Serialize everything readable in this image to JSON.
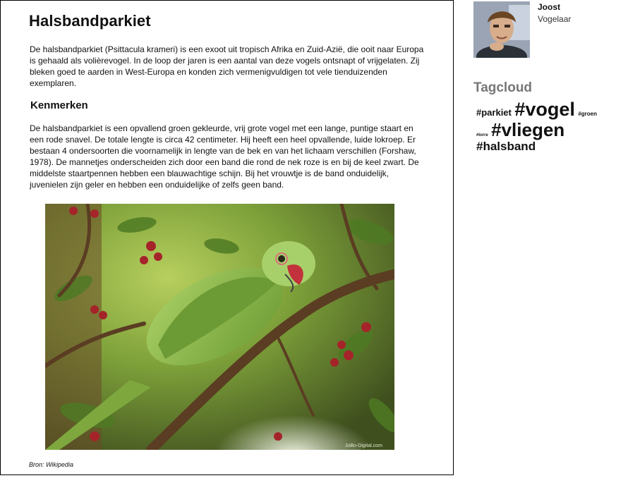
{
  "article": {
    "title": "Halsbandparkiet",
    "intro": "De halsbandparkiet (Psittacula krameri) is een exoot uit tropisch Afrika en Zuid-Azië, die ooit naar Europa is gehaald als volièrevogel. In de loop der jaren is een aantal van deze vogels ontsnapt of vrijgelaten. Zij bleken goed te aarden in West-Europa en konden zich vermenigvuldigen tot vele tienduizenden exemplaren.",
    "section_title": "Kenmerken",
    "section_body": "De halsbandparkiet is een opvallend groen gekleurde, vrij grote vogel met een lange, puntige staart en een rode snavel. De totale lengte is circa 42 centimeter. Hij heeft een heel opvallende, luide lokroep. Er bestaan 4 ondersoorten die voornamelijk in lengte van de bek en van het lichaam verschillen (Forshaw, 1978). De mannetjes onderscheiden zich door een band die rond de nek roze is en bij de keel zwart. De middelste staartpennen hebben een blauwachtige schijn. Bij het vrouwtje is de band onduidelijk, juvenielen zijn geler en hebben een onduidelijke of zelfs geen band.",
    "photo_icon": "parakeet-photo",
    "photo_watermark": "JoBo-Digital.com",
    "source": "Bron: Wikipedia"
  },
  "profile": {
    "name": "Joost",
    "role": "Vogelaar",
    "avatar_icon": "user-avatar"
  },
  "tagcloud": {
    "title": "Tagcloud",
    "tags": [
      "#parkiet",
      "#vogel",
      "#groen",
      "#lorre",
      "#vliegen",
      "#halsband"
    ]
  },
  "colors": {
    "border": "#000000",
    "tagcloud_title": "#777777",
    "parakeet_green": "#8fc04a"
  }
}
